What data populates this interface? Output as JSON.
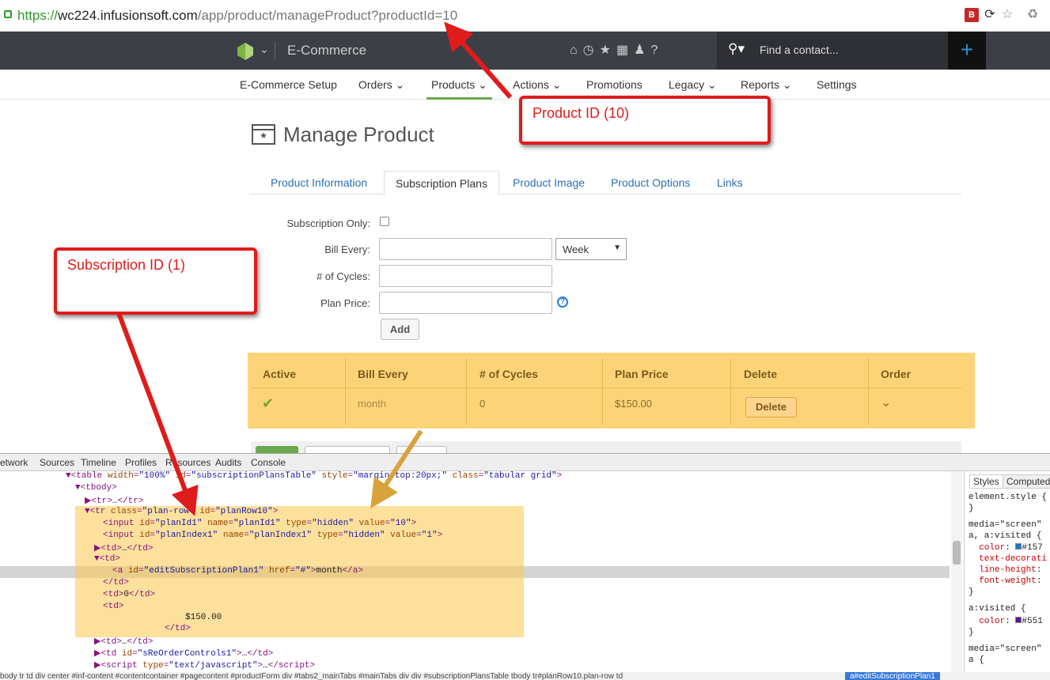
{
  "browser": {
    "url_proto": "https://",
    "url_host": "wc224.infusionsoft.com",
    "url_path": "/app/product/manageProduct?productId=10"
  },
  "topnav": {
    "app_title": "E-Commerce",
    "search_placeholder": "Find a contact...",
    "plus": "+"
  },
  "subnav": {
    "items": [
      "E-Commerce Setup",
      "Orders",
      "Products",
      "Actions",
      "Promotions",
      "Legacy",
      "Reports",
      "Settings"
    ]
  },
  "page": {
    "title": "Manage Product",
    "tabs": [
      "Product Information",
      "Subscription Plans",
      "Product Image",
      "Product Options",
      "Links"
    ]
  },
  "form": {
    "subscription_only_label": "Subscription Only:",
    "bill_every_label": "Bill Every:",
    "bill_every_unit": "Week",
    "cycles_label": "# of Cycles:",
    "plan_price_label": "Plan Price:",
    "add_button": "Add"
  },
  "plans_table": {
    "headers": [
      "Active",
      "Bill Every",
      "# of Cycles",
      "Plan Price",
      "Delete",
      "Order"
    ],
    "row": {
      "bill_every": "month",
      "cycles": "0",
      "price": "$150.00",
      "delete": "Delete"
    }
  },
  "annotations": {
    "product_id": "Product ID (10)",
    "subscription_id": "Subscription ID (1)"
  },
  "devtools": {
    "tabs": [
      "etwork",
      "Sources",
      "Timeline",
      "Profiles",
      "Resources",
      "Audits",
      "Console"
    ],
    "styles_tabs": [
      "Styles",
      "Computed"
    ],
    "breadcrumb_last": "a#editSubscriptionPlan1"
  }
}
